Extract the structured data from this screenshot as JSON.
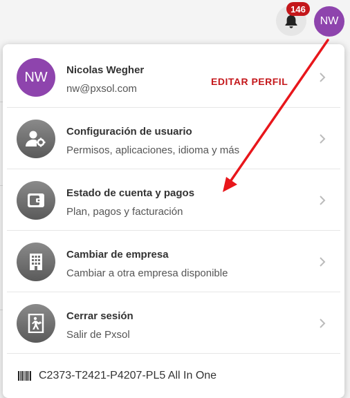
{
  "topbar": {
    "notification_count": "146",
    "avatar_initials": "NW",
    "icons": {
      "notifications": "bell-icon"
    }
  },
  "profile": {
    "avatar_initials": "NW",
    "name": "Nicolas Wegher",
    "email": "nw@pxsol.com",
    "edit_label": "EDITAR PERFIL"
  },
  "menu": [
    {
      "title": "Configuración de usuario",
      "subtitle": "Permisos, aplicaciones, idioma y más",
      "icon": "user-settings-icon"
    },
    {
      "title": "Estado de cuenta y pagos",
      "subtitle": "Plan, pagos y facturación",
      "icon": "wallet-icon"
    },
    {
      "title": "Cambiar de empresa",
      "subtitle": "Cambiar a otra empresa disponible",
      "icon": "building-icon"
    },
    {
      "title": "Cerrar sesión",
      "subtitle": "Salir de Pxsol",
      "icon": "exit-door-icon"
    }
  ],
  "footer": {
    "account_code": "C2373-T2421-P4207-PL5 All In One",
    "icon": "barcode-icon"
  },
  "colors": {
    "brand_red": "#c4171b",
    "avatar_purple": "#8e44ad",
    "annotation_arrow": "#e8161b"
  }
}
